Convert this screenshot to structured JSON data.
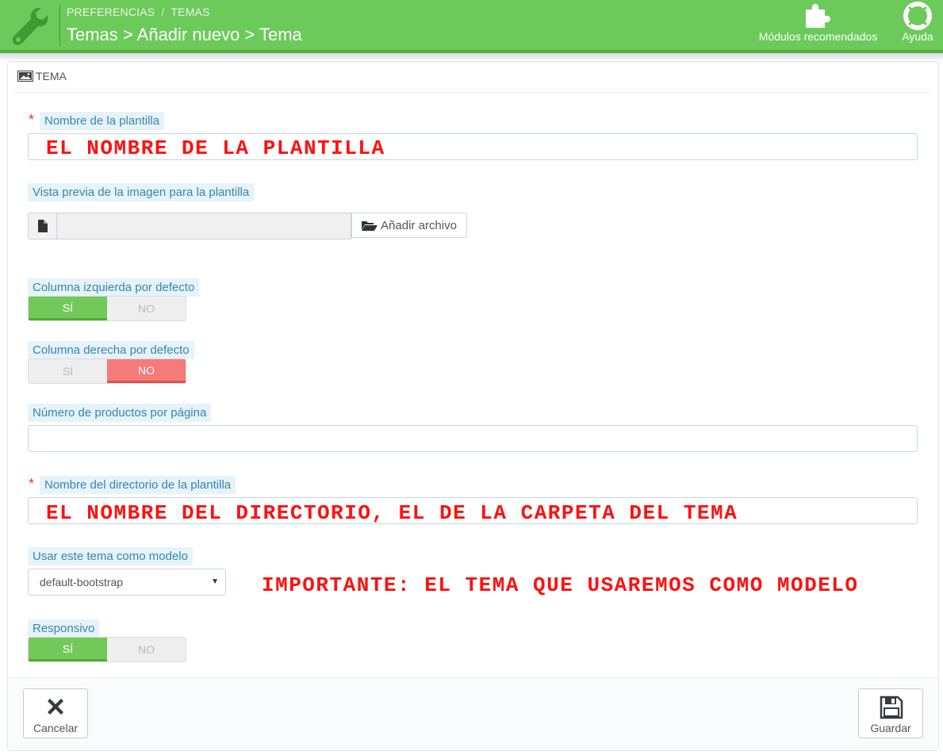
{
  "header": {
    "breadcrumb": [
      "PREFERENCIAS",
      "TEMAS"
    ],
    "breadcrumb_sep": "/",
    "title": "Temas > Añadir nuevo > Tema",
    "tools": {
      "modules_label": "Módulos recomendados",
      "help_label": "Ayuda"
    },
    "colors": {
      "bar": "#6cca5a",
      "bar_border": "#52b040"
    }
  },
  "panel": {
    "heading": "TEMA",
    "heading_icon": "picture-icon"
  },
  "form": {
    "template_name": {
      "label": "Nombre de la plantilla",
      "required": "*",
      "value": ""
    },
    "preview_image": {
      "label": "Vista previa de la imagen para la plantilla",
      "button": "Añadir archivo"
    },
    "left_column": {
      "label": "Columna izquierda por defecto",
      "yes": "SÍ",
      "no": "NO",
      "selected": "yes"
    },
    "right_column": {
      "label": "Columna derecha por defecto",
      "yes": "SÍ",
      "no": "NO",
      "selected": "no"
    },
    "products_per_page": {
      "label": "Número de productos por página",
      "value": ""
    },
    "directory_name": {
      "label": "Nombre del directorio de la plantilla",
      "required": "*",
      "value": ""
    },
    "model_theme": {
      "label": "Usar este tema como modelo",
      "selected": "default-bootstrap"
    },
    "responsive": {
      "label": "Responsivo",
      "yes": "SÍ",
      "no": "NO",
      "selected": "yes"
    }
  },
  "annotations": {
    "template_name": "EL NOMBRE DE LA PLANTILLA",
    "directory_name": "EL NOMBRE DEL DIRECTORIO, EL DE LA CARPETA DEL TEMA",
    "model_theme": "IMPORTANTE: EL TEMA QUE USAREMOS COMO MODELO",
    "color": "#ff1010"
  },
  "footer": {
    "cancel_label": "Cancelar",
    "save_label": "Guardar"
  }
}
